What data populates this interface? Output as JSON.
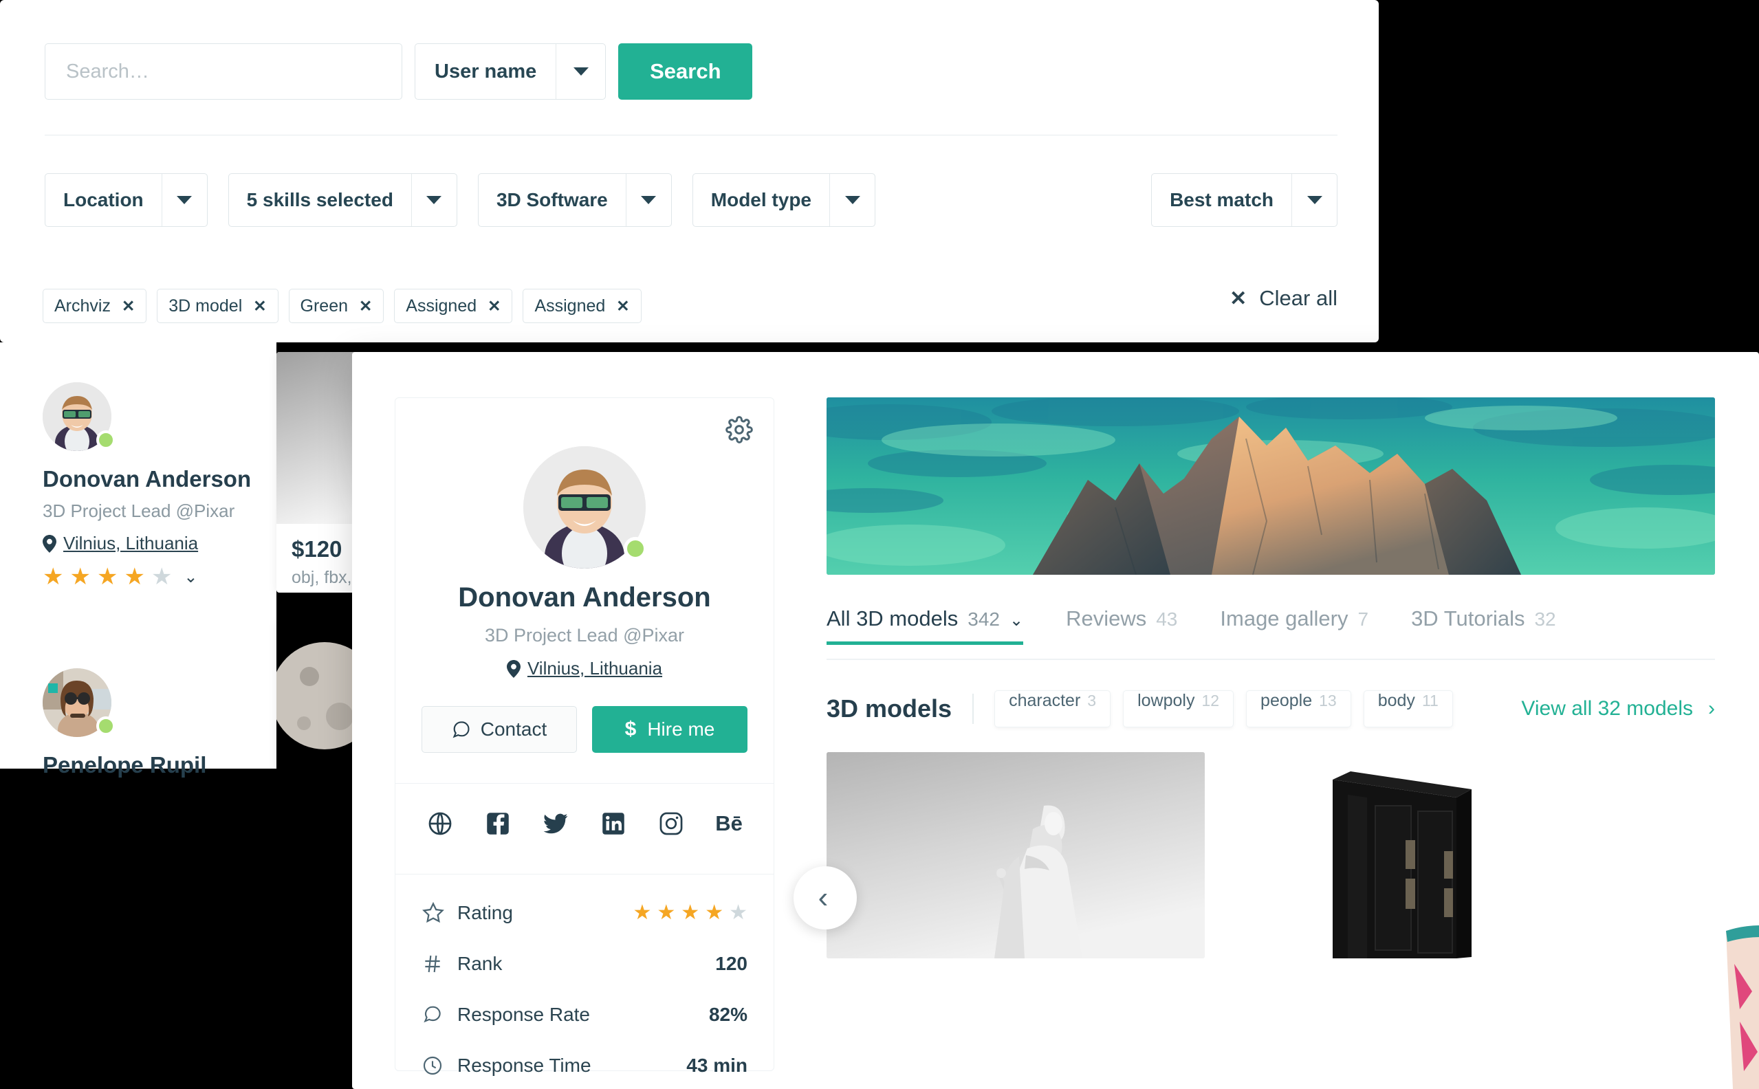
{
  "search": {
    "placeholder": "Search…",
    "value": "",
    "scope_label": "User name",
    "button_label": "Search"
  },
  "filters": [
    {
      "label": "Location"
    },
    {
      "label": "5 skills selected"
    },
    {
      "label": "3D Software"
    },
    {
      "label": "Model type"
    }
  ],
  "sort": {
    "label": "Best match"
  },
  "chips": [
    {
      "label": "Archviz",
      "remove": "✕"
    },
    {
      "label": "3D model",
      "remove": "✕"
    },
    {
      "label": "Green",
      "remove": "✕"
    },
    {
      "label": "Assigned",
      "remove": "✕"
    },
    {
      "label": "Assigned",
      "remove": "✕"
    }
  ],
  "clear_all": {
    "label": "Clear all",
    "icon": "✕"
  },
  "results": [
    {
      "name": "Donovan Anderson",
      "role": "3D Project Lead @Pixar",
      "location": "Vilnius, Lithuania",
      "rating": 4,
      "rating_max": 5
    },
    {
      "name": "Penelope Rupil",
      "role": "",
      "location": "",
      "rating": 0,
      "rating_max": 5
    }
  ],
  "result_thumb": {
    "price": "$120",
    "formats": "obj, fbx,"
  },
  "profile": {
    "name": "Donovan Anderson",
    "role": "3D Project Lead @Pixar",
    "location": "Vilnius, Lithuania",
    "settings_icon": "gear-icon",
    "contact_label": "Contact",
    "hire_label": "Hire me",
    "hire_icon": "$",
    "socials": [
      "globe-icon",
      "facebook-icon",
      "twitter-icon",
      "linkedin-icon",
      "instagram-icon",
      "behance-icon"
    ],
    "stats": [
      {
        "icon": "star-outline-icon",
        "label": "Rating",
        "type": "stars",
        "value": 4,
        "max": 5
      },
      {
        "icon": "hash-icon",
        "label": "Rank",
        "type": "text",
        "value": "120"
      },
      {
        "icon": "chat-reply-icon",
        "label": "Response Rate",
        "type": "text",
        "value": "82%"
      },
      {
        "icon": "clock-icon",
        "label": "Response Time",
        "type": "text",
        "value": "43 min"
      }
    ]
  },
  "tabs": [
    {
      "label": "All 3D models",
      "count": "342",
      "active": true,
      "chevron": "⌄"
    },
    {
      "label": "Reviews",
      "count": "43",
      "active": false
    },
    {
      "label": "Image gallery",
      "count": "7",
      "active": false
    },
    {
      "label": "3D Tutorials",
      "count": "32",
      "active": false
    }
  ],
  "models_section": {
    "title": "3D models",
    "tags": [
      {
        "label": "character",
        "count": "3"
      },
      {
        "label": "lowpoly",
        "count": "12"
      },
      {
        "label": "people",
        "count": "13"
      },
      {
        "label": "body",
        "count": "11"
      }
    ],
    "view_all": "View all 32 models",
    "view_all_chevron": "›",
    "prev_chevron": "‹"
  },
  "colors": {
    "accent": "#22b194",
    "text_dark": "#263f4d",
    "text_muted": "#8b99a1",
    "border": "#dfe6e9",
    "star": "#f5a623",
    "online": "#a5dc6f"
  }
}
